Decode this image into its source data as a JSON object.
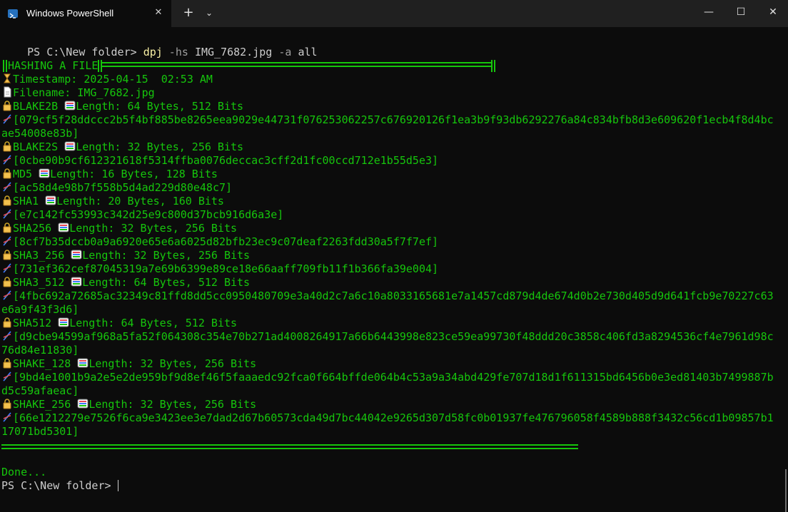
{
  "window": {
    "tab_title": "Windows PowerShell",
    "tab_close": "✕",
    "new_tab": "+",
    "dropdown": "⌄",
    "minimize": "—",
    "maximize": "☐",
    "close": "✕"
  },
  "command": {
    "prompt": "PS C:\\New folder> ",
    "exe": "dpj",
    "flag1": " -hs ",
    "file": "IMG_7682.jpg",
    "flag2": " -a ",
    "arg": "all"
  },
  "header": {
    "title": "HASHING A FILE"
  },
  "meta": {
    "timestamp": "Timestamp: 2025-04-15  02:53 AM",
    "filename": "Filename: IMG_7682.jpg"
  },
  "hashes": [
    {
      "name": "BLAKE2B ",
      "length": "Length: 64 Bytes, 512 Bits",
      "lines": [
        "[079cf5f28ddccc2b5f4bf885be8265eea9029e44731f076253062257c676920126f1ea3b9f93db6292276a84c834bfb8d3e609620f1ecb4f8d4bc",
        "ae54008e83b]"
      ]
    },
    {
      "name": "BLAKE2S ",
      "length": "Length: 32 Bytes, 256 Bits",
      "lines": [
        "[0cbe90b9cf612321618f5314ffba0076deccac3cff2d1fc00ccd712e1b55d5e3]"
      ]
    },
    {
      "name": "MD5 ",
      "length": "Length: 16 Bytes, 128 Bits",
      "lines": [
        "[ac58d4e98b7f558b5d4ad229d80e48c7]"
      ]
    },
    {
      "name": "SHA1 ",
      "length": "Length: 20 Bytes, 160 Bits",
      "lines": [
        "[e7c142fc53993c342d25e9c800d37bcb916d6a3e]"
      ]
    },
    {
      "name": "SHA256 ",
      "length": "Length: 32 Bytes, 256 Bits",
      "lines": [
        "[8cf7b35dccb0a9a6920e65e6a6025d82bfb23ec9c07deaf2263fdd30a5f7f7ef]"
      ]
    },
    {
      "name": "SHA3_256 ",
      "length": "Length: 32 Bytes, 256 Bits",
      "lines": [
        "[731ef362cef87045319a7e69b6399e89ce18e66aaff709fb11f1b366fa39e004]"
      ]
    },
    {
      "name": "SHA3_512 ",
      "length": "Length: 64 Bytes, 512 Bits",
      "lines": [
        "[4fbc692a72685ac32349c81ffd8dd5cc0950480709e3a40d2c7a6c10a8033165681e7a1457cd879d4de674d0b2e730d405d9d641fcb9e70227c63",
        "e6a9f43f3d6]"
      ]
    },
    {
      "name": "SHA512 ",
      "length": "Length: 64 Bytes, 512 Bits",
      "lines": [
        "[d9cbe94599af968a5fa52f064308c354e70b271ad4008264917a66b6443998e823ce59ea99730f48ddd20c3858c406fd3a8294536cf4e7961d98c",
        "76d84e11830]"
      ]
    },
    {
      "name": "SHAKE_128 ",
      "length": "Length: 32 Bytes, 256 Bits",
      "lines": [
        "[9bd4e1001b9a2e5e2de959bf9d8ef46f5faaaedc92fca0f664bffde064b4c53a9a34abd429fe707d18d1f611315bd6456b0e3ed81403b7499887b",
        "d5c59afaeac]"
      ]
    },
    {
      "name": "SHAKE_256 ",
      "length": "Length: 32 Bytes, 256 Bits",
      "lines": [
        "[66e1212279e7526f6ca9e3423ee3e7dad2d67b60573cda49d7bc44042e9265d307d58fc0b01937fe476796058f4589b888f3432c56cd1b09857b1",
        "17071bd5301]"
      ]
    }
  ],
  "footer": {
    "done": "Done...",
    "prompt": "PS C:\\New folder> "
  },
  "colors": {
    "green": "#16c60c",
    "yellow": "#f9f1a5",
    "background": "#0c0c0c"
  }
}
